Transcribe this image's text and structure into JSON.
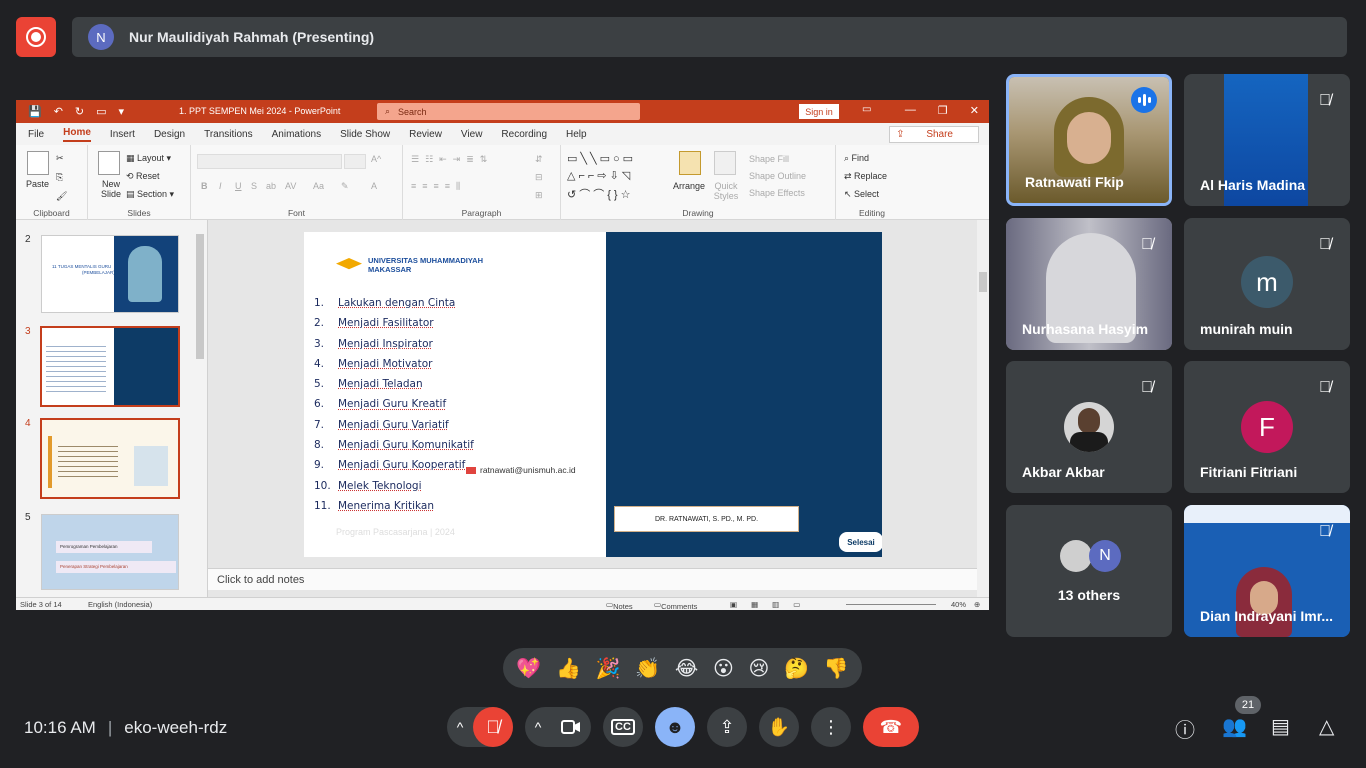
{
  "presenter": {
    "initial": "N",
    "label": "Nur Maulidiyah Rahmah (Presenting)"
  },
  "ppt": {
    "title": "1. PPT SEMPEN Mei 2024  -  PowerPoint",
    "search_placeholder": "Search",
    "signin": "Sign in",
    "tabs": [
      "File",
      "Home",
      "Insert",
      "Design",
      "Transitions",
      "Animations",
      "Slide Show",
      "Review",
      "View",
      "Recording",
      "Help"
    ],
    "share": "Share",
    "ribbon": {
      "paste": "Paste",
      "clipboard": "Clipboard",
      "new_slide": "New Slide",
      "layout": "Layout",
      "reset": "Reset",
      "section": "Section",
      "slides": "Slides",
      "font": "Font",
      "paragraph": "Paragraph",
      "arrange": "Arrange",
      "quick_styles": "Quick Styles",
      "shape_fill": "Shape Fill",
      "shape_outline": "Shape Outline",
      "shape_effects": "Shape Effects",
      "drawing": "Drawing",
      "find": "Find",
      "replace": "Replace",
      "select": "Select",
      "editing": "Editing"
    },
    "thumbs": [
      {
        "num": "2",
        "title": "11 TUGAS MENTALIS GURU",
        "subtitle": "(PEMBELAJAR)"
      },
      {
        "num": "3"
      },
      {
        "num": "4"
      },
      {
        "num": "5",
        "item1": "Pemrograman Pembelajaran",
        "item2": "Penerapan Strategi Pembelajaran"
      }
    ],
    "slide": {
      "logo_line1": "UNIVERSITAS MUHAMMADIYAH",
      "logo_line2": "MAKASSAR",
      "items": [
        {
          "n": "1.",
          "t": "Lakukan dengan  Cinta"
        },
        {
          "n": "2.",
          "t": "Menjadi Fasilitator"
        },
        {
          "n": "3.",
          "t": "Menjadi Inspirator"
        },
        {
          "n": "4.",
          "t": "Menjadi Motivator"
        },
        {
          "n": "5.",
          "t": "Menjadi Teladan"
        },
        {
          "n": "6.",
          "t": "Menjadi Guru Kreatif"
        },
        {
          "n": "7.",
          "t": "Menjadi Guru Variatif"
        },
        {
          "n": "8.",
          "t": "Menjadi Guru Komunikatif"
        },
        {
          "n": "9.",
          "t": "Menjadi Guru Kooperatif"
        },
        {
          "n": "10.",
          "t": "Melek Teknologi"
        },
        {
          "n": "11.",
          "t": "Menerima Kritikan"
        }
      ],
      "email": "ratnawati@unismuh.ac.id",
      "footer": "Program Pascasarjana | 2024",
      "name_box": "DR. RATNAWATI, S. PD., M. PD.",
      "selesai": "Selesai"
    },
    "notes_placeholder": "Click to add notes",
    "status": {
      "slide_of": "Slide 3 of 14",
      "language": "English (Indonesia)",
      "notes": "Notes",
      "comments": "Comments",
      "zoom": "40%"
    }
  },
  "participants": [
    {
      "name": "Ratnawati Fkip",
      "speaking": true
    },
    {
      "name": "Al Haris Madina"
    },
    {
      "name": "Nurhasana Hasyim"
    },
    {
      "name": "munirah muin",
      "initial": "m",
      "color": "#3c5a6b"
    },
    {
      "name": "Akbar Akbar"
    },
    {
      "name": "Fitriani Fitriani",
      "initial": "F",
      "color": "#c2185b"
    },
    {
      "name": "13 others",
      "initial": "N"
    },
    {
      "name": "Dian Indrayani Imr..."
    }
  ],
  "reactions": [
    "💖",
    "👍",
    "🎉",
    "👏",
    "😂",
    "😮",
    "😢",
    "🤔",
    "👎"
  ],
  "bottom": {
    "time": "10:16 AM",
    "meeting_code": "eko-weeh-rdz",
    "people_count": "21"
  },
  "colors": {
    "ppt_accent": "#c43e1c",
    "meet_red": "#ea4335",
    "meet_blue": "#8ab4f8",
    "slide_blue": "#0d3b66"
  }
}
